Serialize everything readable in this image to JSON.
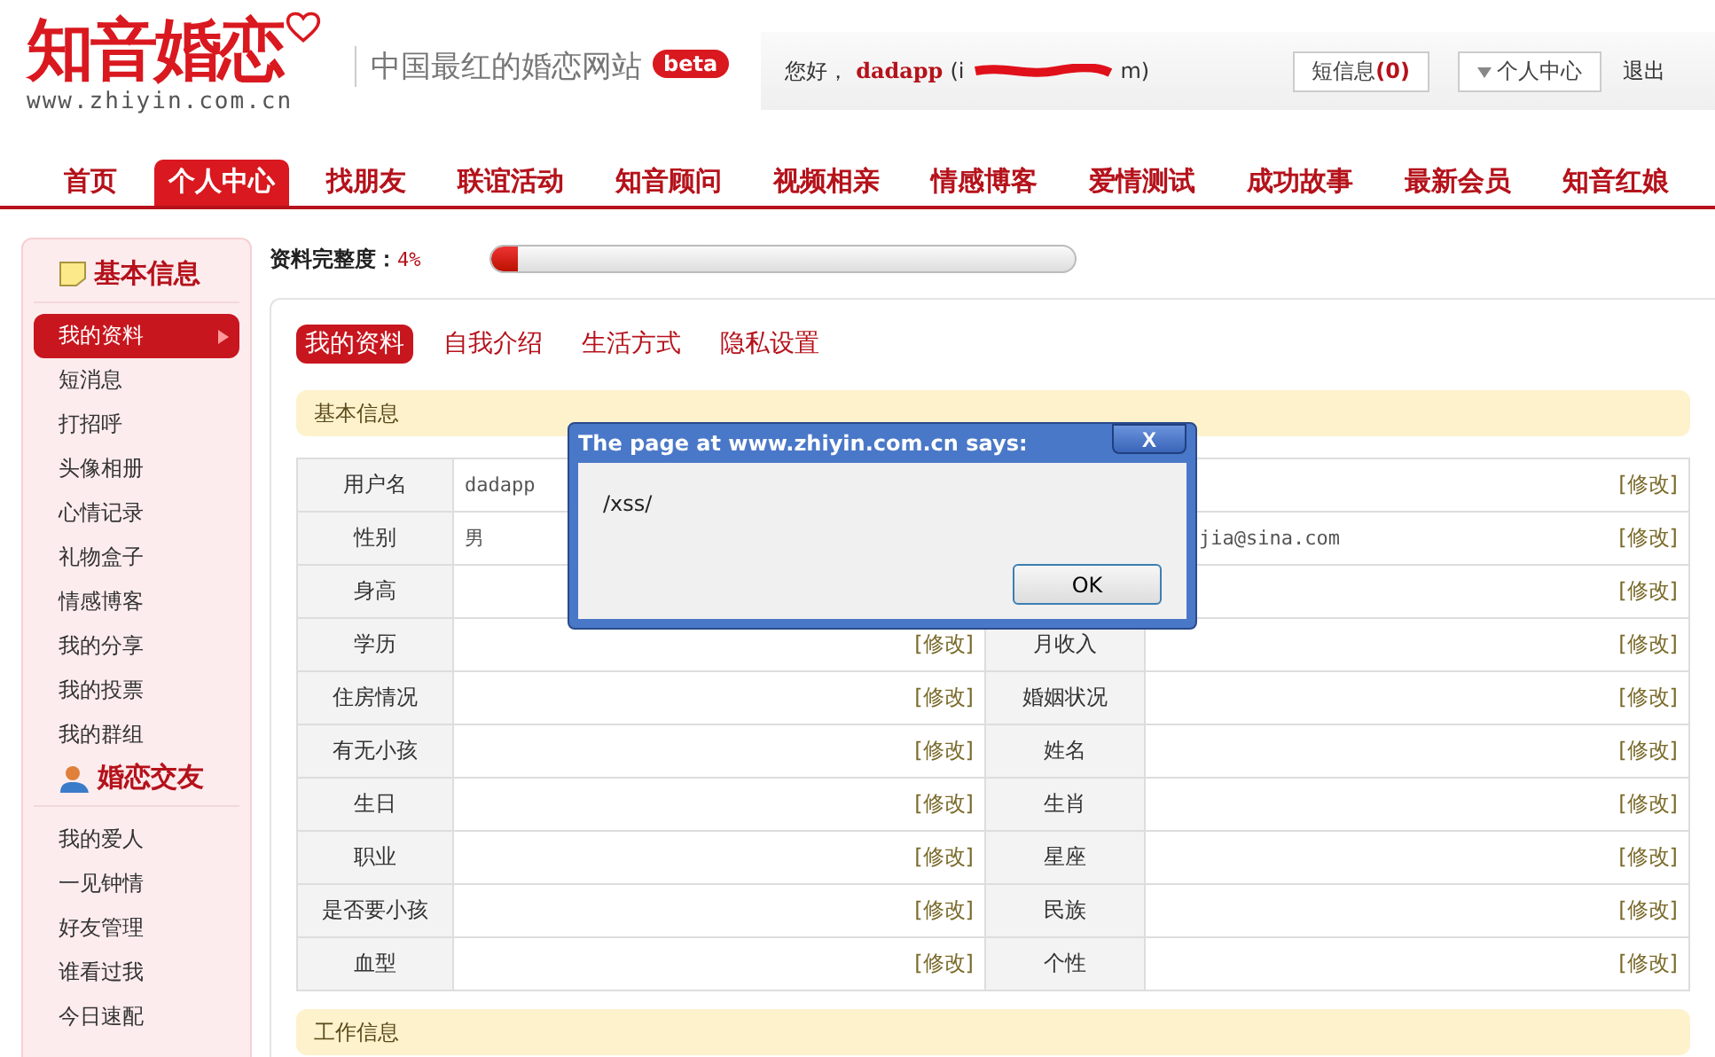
{
  "logo": {
    "name": "知音婚恋",
    "url": "www.zhiyin.com.cn"
  },
  "slogan": "中国最红的婚恋网站",
  "badge": "beta",
  "user_bar": {
    "greeting": "您好，",
    "username": "dadapp",
    "email_start": "(i",
    "email_end": "m)",
    "messages": "短信息",
    "message_count": "(0)",
    "menu": "个人中心",
    "logout": "退出"
  },
  "nav": [
    {
      "label": "首页",
      "selected": false
    },
    {
      "label": "个人中心",
      "selected": true
    },
    {
      "label": "找朋友",
      "selected": false
    },
    {
      "label": "联谊活动",
      "selected": false
    },
    {
      "label": "知音顾问",
      "selected": false
    },
    {
      "label": "视频相亲",
      "selected": false
    },
    {
      "label": "情感博客",
      "selected": false
    },
    {
      "label": "爱情测试",
      "selected": false
    },
    {
      "label": "成功故事",
      "selected": false
    },
    {
      "label": "最新会员",
      "selected": false
    },
    {
      "label": "知音红娘",
      "selected": false
    }
  ],
  "sidebar": [
    {
      "title": "基本信息",
      "kind": "note",
      "items": [
        {
          "label": "我的资料",
          "selected": true
        },
        {
          "label": "短消息",
          "selected": false
        },
        {
          "label": "打招呼",
          "selected": false
        },
        {
          "label": "头像相册",
          "selected": false
        },
        {
          "label": "心情记录",
          "selected": false
        },
        {
          "label": "礼物盒子",
          "selected": false
        },
        {
          "label": "情感博客",
          "selected": false
        },
        {
          "label": "我的分享",
          "selected": false
        },
        {
          "label": "我的投票",
          "selected": false
        },
        {
          "label": "我的群组",
          "selected": false
        }
      ]
    },
    {
      "title": "婚恋交友",
      "kind": "person",
      "items": [
        {
          "label": "我的爱人",
          "selected": false
        },
        {
          "label": "一见钟情",
          "selected": false
        },
        {
          "label": "好友管理",
          "selected": false
        },
        {
          "label": "谁看过我",
          "selected": false
        },
        {
          "label": "今日速配",
          "selected": false
        }
      ]
    }
  ],
  "completeness": {
    "label": "资料完整度：",
    "value": "4%",
    "level": 0.045
  },
  "tabs": [
    {
      "label": "我的资料",
      "selected": true
    },
    {
      "label": "自我介绍",
      "selected": false
    },
    {
      "label": "生活方式",
      "selected": false
    },
    {
      "label": "隐私设置",
      "selected": false
    }
  ],
  "sections": [
    {
      "title": "基本信息",
      "rows": [
        {
          "label": "用户名",
          "value": "dadapp",
          "edit2": "[修改]"
        },
        {
          "label": "性别",
          "value": "男",
          "value2": "jia@sina.com",
          "edit2": "[修改]"
        },
        {
          "label": "身高",
          "edit2": "[修改]"
        },
        {
          "label": "学历",
          "edit": "[修改]",
          "label2": "月收入",
          "edit2": "[修改]"
        },
        {
          "label": "住房情况",
          "edit": "[修改]",
          "label2": "婚姻状况",
          "edit2": "[修改]"
        },
        {
          "label": "有无小孩",
          "edit": "[修改]",
          "label2": "姓名",
          "edit2": "[修改]"
        },
        {
          "label": "生日",
          "edit": "[修改]",
          "label2": "生肖",
          "edit2": "[修改]"
        },
        {
          "label": "职业",
          "edit": "[修改]",
          "label2": "星座",
          "edit2": "[修改]"
        },
        {
          "label": "是否要小孩",
          "edit": "[修改]",
          "label2": "民族",
          "edit2": "[修改]"
        },
        {
          "label": "血型",
          "edit": "[修改]",
          "label2": "个性",
          "edit2": "[修改]"
        }
      ]
    },
    {
      "title": "工作信息"
    }
  ],
  "dialog": {
    "title": "The page at www.zhiyin.com.cn says:",
    "close": "X",
    "message": "/xss/",
    "button": "OK"
  }
}
